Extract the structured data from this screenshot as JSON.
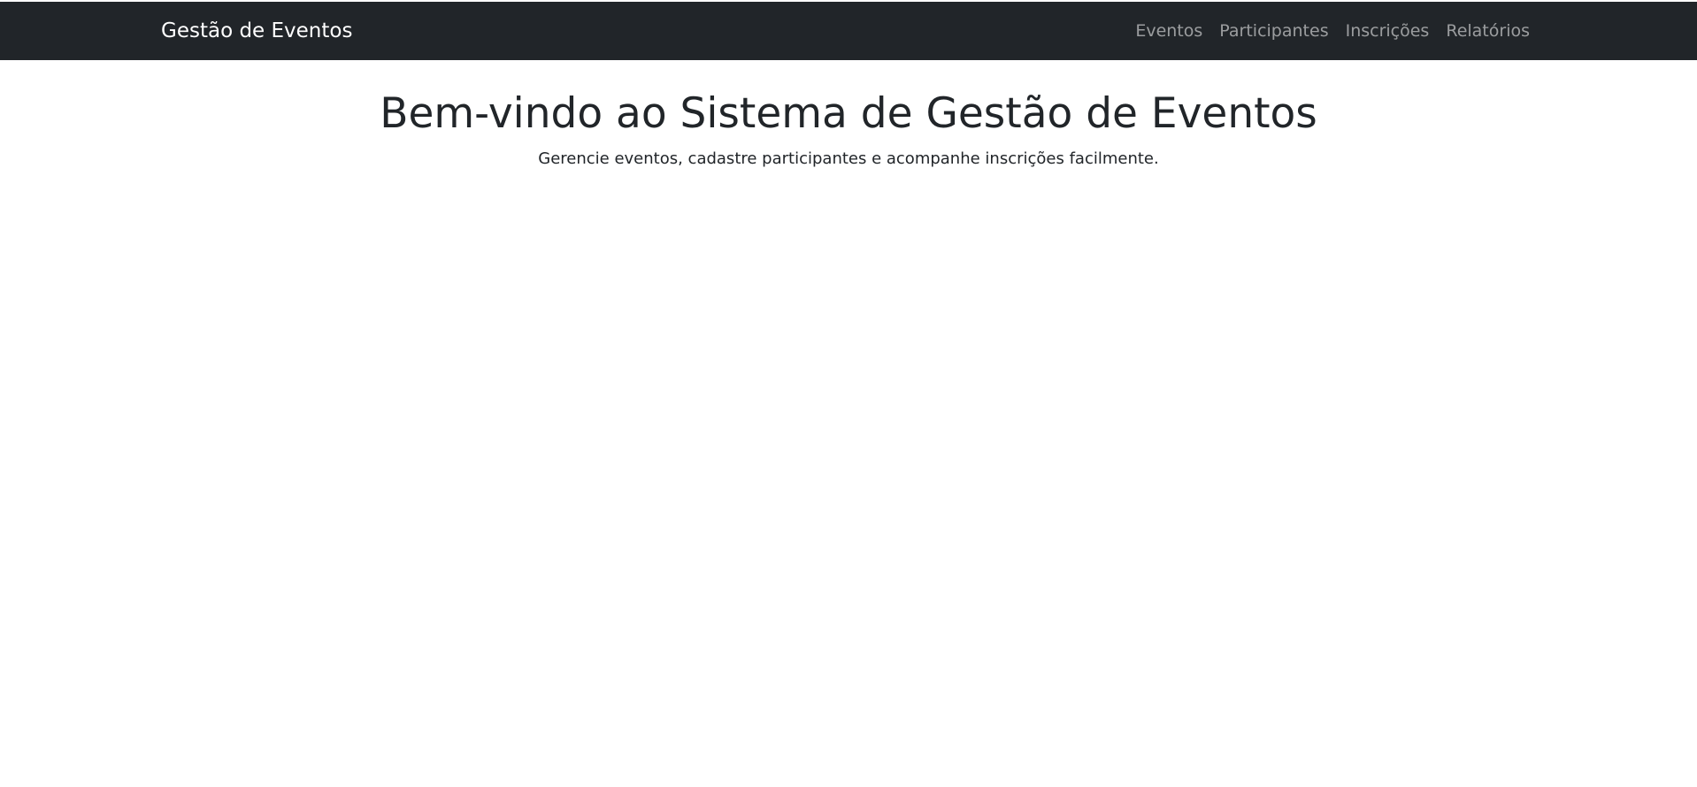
{
  "navbar": {
    "brand": "Gestão de Eventos",
    "links": [
      {
        "label": "Eventos"
      },
      {
        "label": "Participantes"
      },
      {
        "label": "Inscrições"
      },
      {
        "label": "Relatórios"
      }
    ]
  },
  "hero": {
    "title": "Bem-vindo ao Sistema de Gestão de Eventos",
    "subtitle": "Gerencie eventos, cadastre participantes e acompanhe inscrições facilmente."
  }
}
